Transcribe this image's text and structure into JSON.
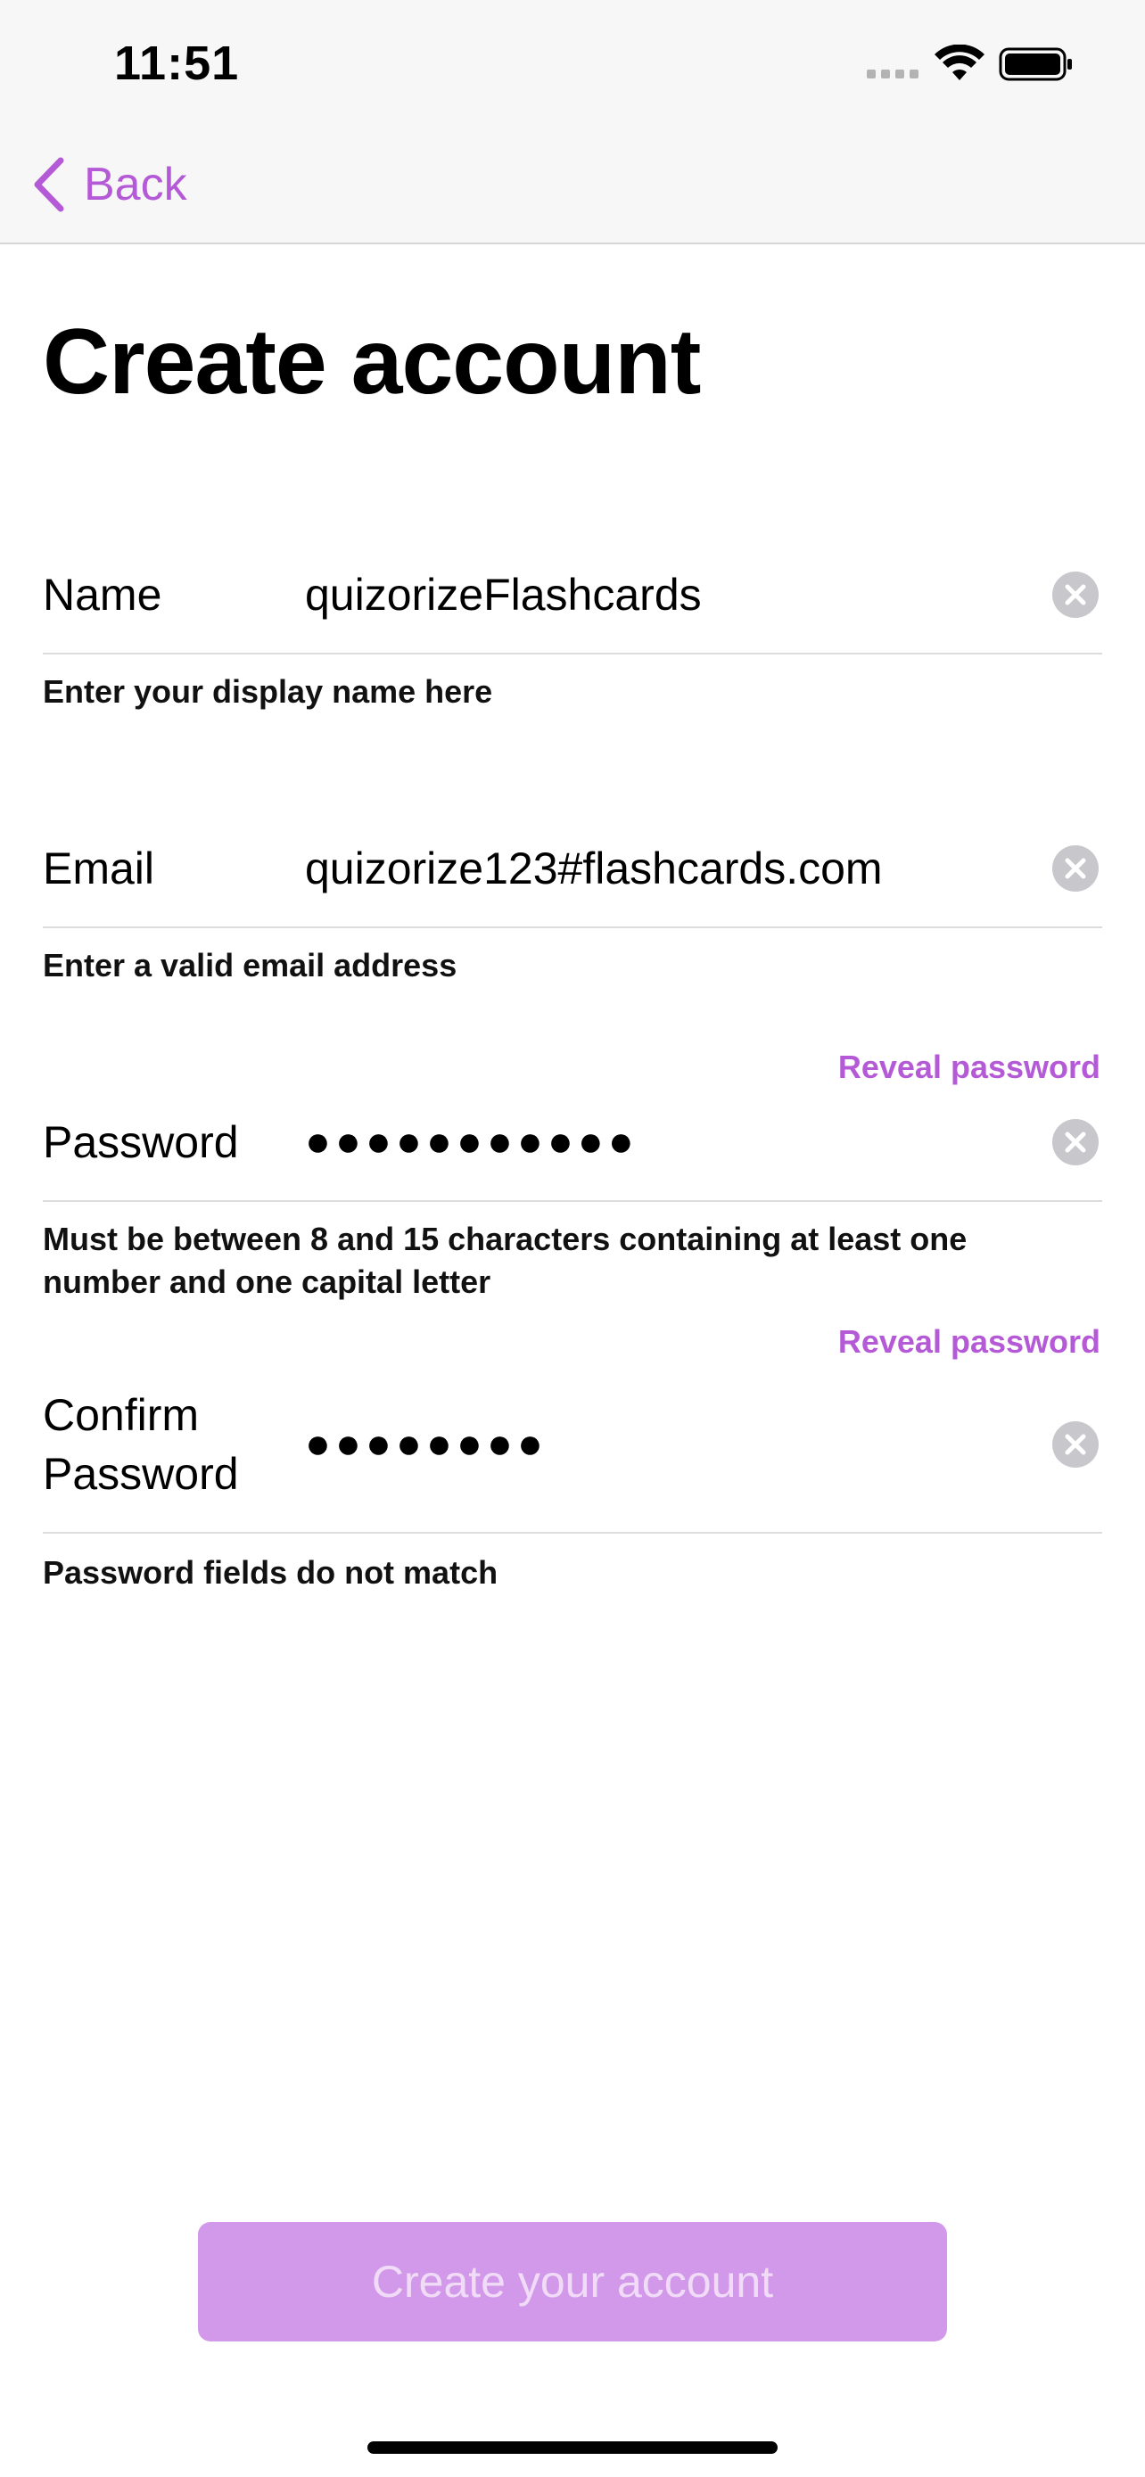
{
  "status_bar": {
    "time": "11:51"
  },
  "nav": {
    "back_label": "Back"
  },
  "page": {
    "title": "Create account"
  },
  "fields": {
    "name": {
      "label": "Name",
      "value": "quizorizeFlashcards",
      "helper": "Enter your display name here"
    },
    "email": {
      "label": "Email",
      "value": "quizorize123#flashcards.com",
      "helper": "Enter a valid email address"
    },
    "password": {
      "label": "Password",
      "value": "●●●●●●●●●●●",
      "reveal_label": "Reveal password",
      "helper_line1": "Must be between 8 and 15 characters containing at least one",
      "helper_line2": "number and one capital letter"
    },
    "confirm_password": {
      "label_line1": "Confirm",
      "label_line2": "Password",
      "value": "●●●●●●●●",
      "reveal_label": "Reveal password",
      "helper": "Password fields do not match"
    }
  },
  "actions": {
    "create_label": "Create your account"
  },
  "colors": {
    "accent": "#b55ad6",
    "button_disabled_bg": "#d299ea",
    "button_disabled_text": "#f1dcf8",
    "nav_background": "#f7f7f7"
  },
  "icons": [
    "signal-icon",
    "wifi-icon",
    "battery-icon",
    "chevron-left-icon",
    "clear-icon"
  ]
}
